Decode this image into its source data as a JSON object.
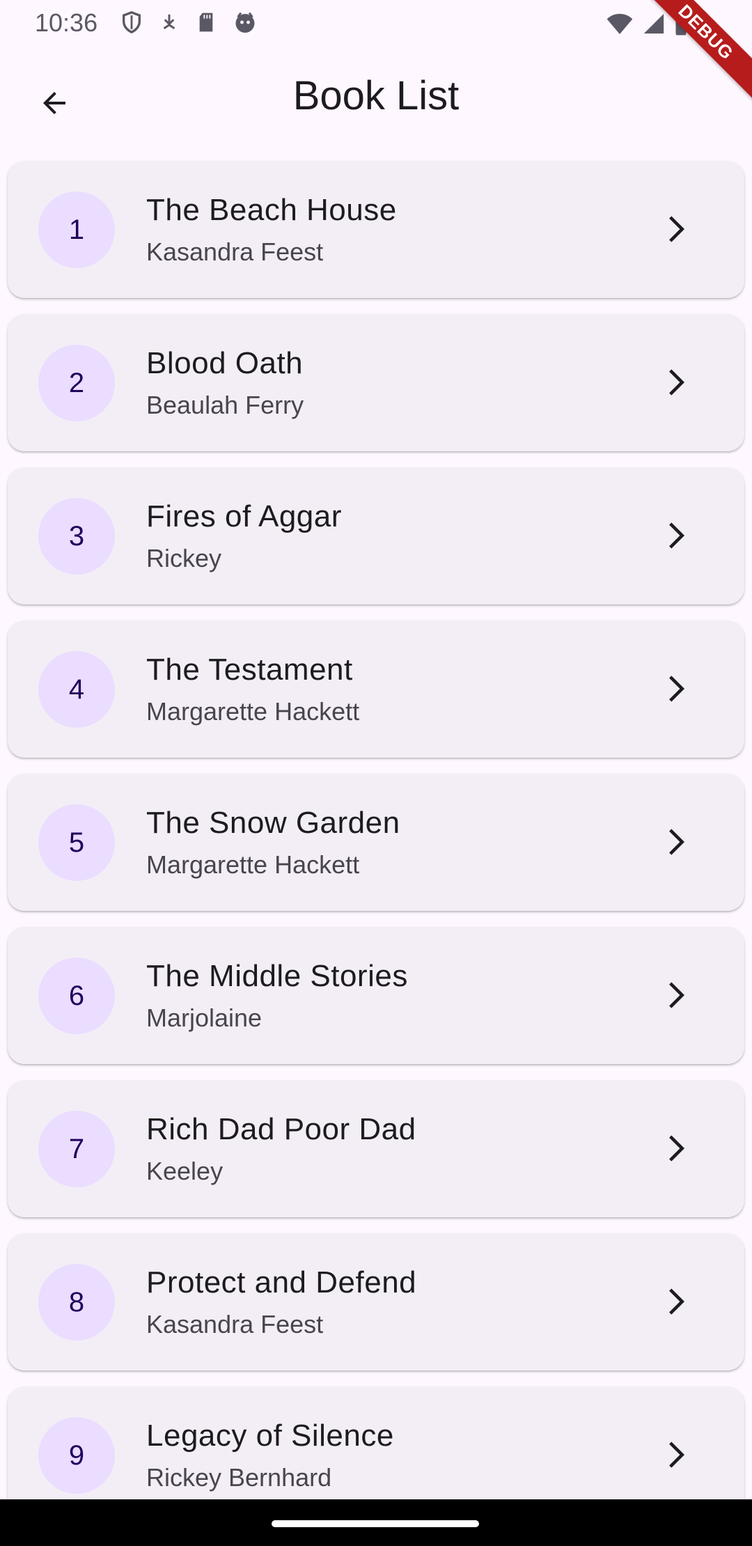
{
  "status_bar": {
    "time": "10:36",
    "left_icons": [
      "shield-icon",
      "download-icon",
      "sd-card-icon",
      "face-icon"
    ],
    "right_icons": [
      "wifi-icon",
      "signal-icon",
      "battery-icon"
    ]
  },
  "debug_banner": "DEBUG",
  "app_bar": {
    "back_icon": "arrow-back-icon",
    "title": "Book List"
  },
  "books": [
    {
      "index": "1",
      "title": "The Beach House",
      "author": "Kasandra Feest"
    },
    {
      "index": "2",
      "title": "Blood Oath",
      "author": "Beaulah Ferry"
    },
    {
      "index": "3",
      "title": "Fires of Aggar",
      "author": "Rickey"
    },
    {
      "index": "4",
      "title": "The Testament",
      "author": "Margarette Hackett"
    },
    {
      "index": "5",
      "title": "The Snow Garden",
      "author": "Margarette Hackett"
    },
    {
      "index": "6",
      "title": "The Middle Stories",
      "author": "Marjolaine"
    },
    {
      "index": "7",
      "title": "Rich Dad Poor Dad",
      "author": "Keeley"
    },
    {
      "index": "8",
      "title": "Protect and Defend",
      "author": "Kasandra Feest"
    },
    {
      "index": "9",
      "title": "Legacy of Silence",
      "author": "Rickey Bernhard"
    }
  ],
  "colors": {
    "background": "#fef7ff",
    "card": "#f3eef6",
    "avatar_bg": "#eaddff",
    "avatar_text": "#21005d",
    "title_text": "#1d1b20",
    "subtitle_text": "#49454f",
    "debug_ribbon": "#b71c1c"
  }
}
